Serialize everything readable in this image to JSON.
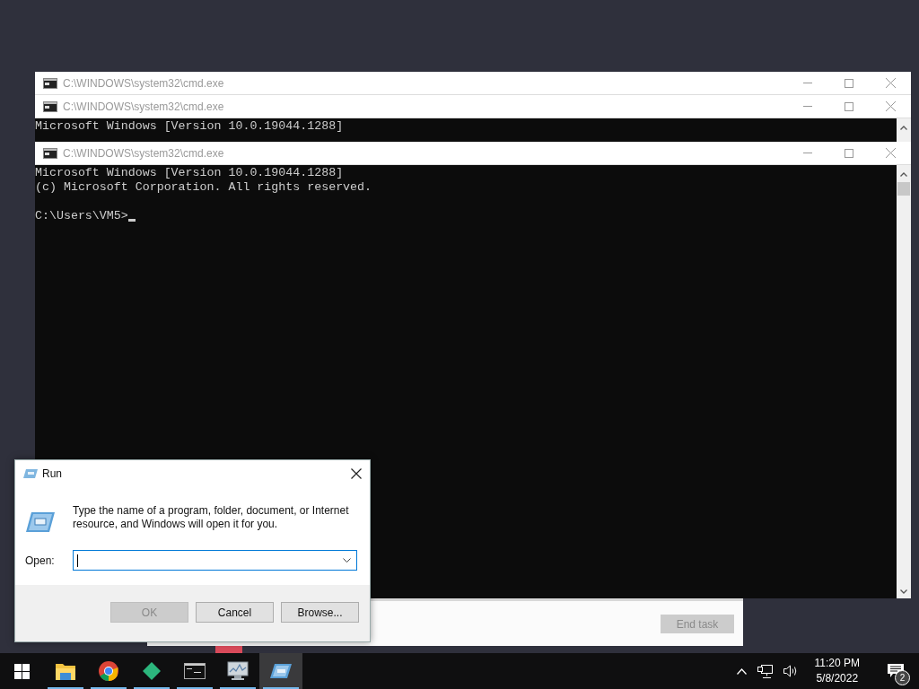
{
  "windows": [
    {
      "kind": "console",
      "title": "C:\\WINDOWS\\system32\\cmd.exe"
    },
    {
      "kind": "console",
      "title": "C:\\WINDOWS\\system32\\cmd.exe",
      "lines": [
        "Microsoft Windows [Version 10.0.19044.1288]"
      ]
    },
    {
      "kind": "console",
      "title": "C:\\WINDOWS\\system32\\cmd.exe",
      "lines": [
        "Microsoft Windows [Version 10.0.19044.1288]",
        "(c) Microsoft Corporation. All rights reserved."
      ],
      "prompt": "C:\\Users\\VM5>"
    }
  ],
  "task_manager": {
    "end_task_button": {
      "label": "End task",
      "disabled": true
    }
  },
  "run_dialog": {
    "title": "Run",
    "message": "Type the name of a program, folder, document, or Internet resource, and Windows will open it for you.",
    "open_label": "Open:",
    "buttons": [
      {
        "label": "OK",
        "disabled": true
      },
      {
        "label": "Cancel",
        "disabled": false
      },
      {
        "label": "Browse...",
        "disabled": false
      }
    ]
  },
  "taskbar": {
    "apps": [
      {
        "kind": "explorer",
        "running": true,
        "selected": false
      },
      {
        "kind": "browser",
        "running": true,
        "selected": false
      },
      {
        "kind": "diamond",
        "running": true,
        "selected": false
      },
      {
        "kind": "console",
        "running": true,
        "selected": false
      },
      {
        "kind": "monitor",
        "running": true,
        "selected": false
      },
      {
        "kind": "run",
        "running": true,
        "selected": true
      }
    ],
    "time": "11:20 PM",
    "date": "5/8/2022",
    "notification_count": "2"
  }
}
